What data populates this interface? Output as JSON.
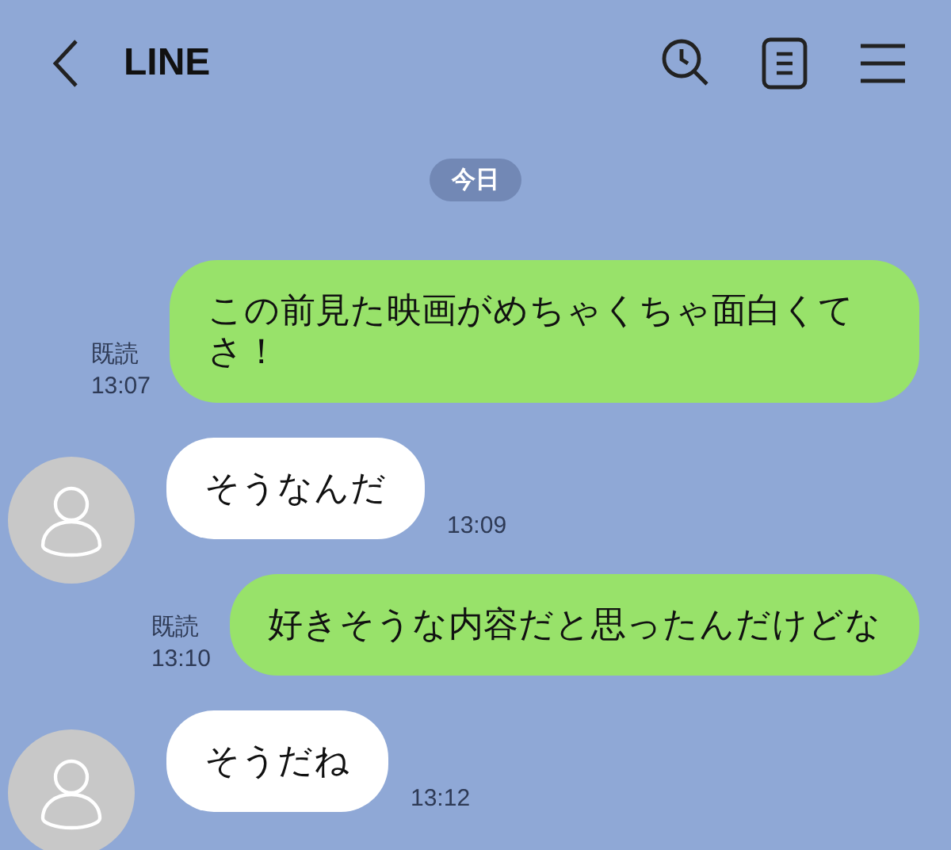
{
  "header": {
    "title": "LINE"
  },
  "date_label": "今日",
  "messages": [
    {
      "kind": "out",
      "text": "この前見た映画がめちゃくちゃ面白くてさ！",
      "read": "既読",
      "time": "13:07"
    },
    {
      "kind": "in",
      "text": "そうなんだ",
      "time": "13:09"
    },
    {
      "kind": "out",
      "text": "好きそうな内容だと思ったんだけどな",
      "read": "既読",
      "time": "13:10"
    },
    {
      "kind": "in",
      "text": "そうだね",
      "time": "13:12"
    }
  ]
}
